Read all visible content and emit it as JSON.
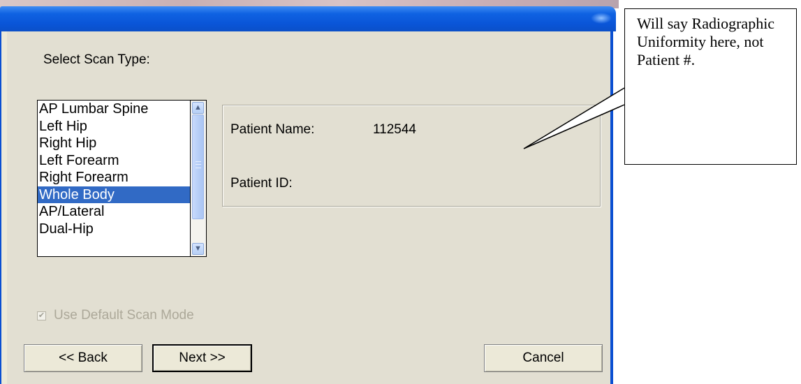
{
  "dialog": {
    "select_scan_type_label": "Select Scan Type:",
    "scan_types": [
      "AP Lumbar Spine",
      "Left Hip",
      "Right Hip",
      "Left Forearm",
      "Right Forearm",
      "Whole Body",
      "AP/Lateral",
      "Dual-Hip"
    ],
    "selected_scan_type": "Whole Body",
    "patient_name_label": "Patient Name:",
    "patient_name_value": "112544",
    "patient_id_label": "Patient ID:",
    "patient_id_value": "",
    "default_scan_mode": {
      "label": "Use Default Scan Mode",
      "checked": true,
      "enabled": false
    },
    "buttons": {
      "back": "<< Back",
      "next": "Next >>",
      "cancel": "Cancel"
    }
  },
  "callout": {
    "text": "Will say Radiographic Uniformity here, not Patient #."
  },
  "colors": {
    "title_bar": "#0a55d8",
    "selection": "#316ac5",
    "window_body": "#ece9d8"
  }
}
